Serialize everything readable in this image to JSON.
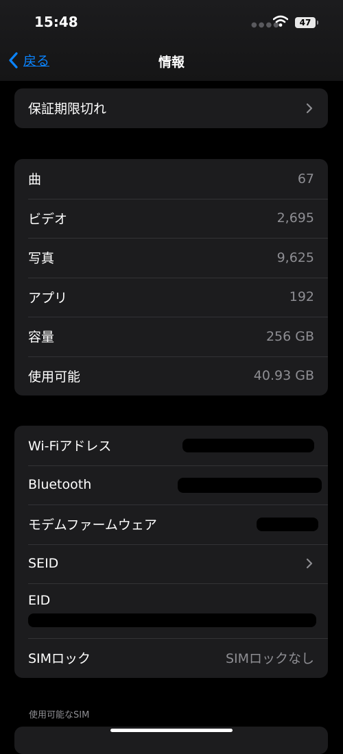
{
  "status": {
    "time": "15:48",
    "battery": "47"
  },
  "nav": {
    "back_label": "戻る",
    "title": "情報"
  },
  "warranty": {
    "label": "保証期限切れ"
  },
  "stats": [
    {
      "label": "曲",
      "value": "67"
    },
    {
      "label": "ビデオ",
      "value": "2,695"
    },
    {
      "label": "写真",
      "value": "9,625"
    },
    {
      "label": "アプリ",
      "value": "192"
    },
    {
      "label": "容量",
      "value": "256 GB"
    },
    {
      "label": "使用可能",
      "value": "40.93 GB"
    }
  ],
  "device": {
    "wifi_label": "Wi-Fiアドレス",
    "bluetooth_label": "Bluetooth",
    "modem_label": "モデムファームウェア",
    "seid_label": "SEID",
    "eid_label": "EID",
    "sim_lock_label": "SIMロック",
    "sim_lock_value": "SIMロックなし"
  },
  "sim_section": {
    "caption": "使用可能なSIM"
  }
}
